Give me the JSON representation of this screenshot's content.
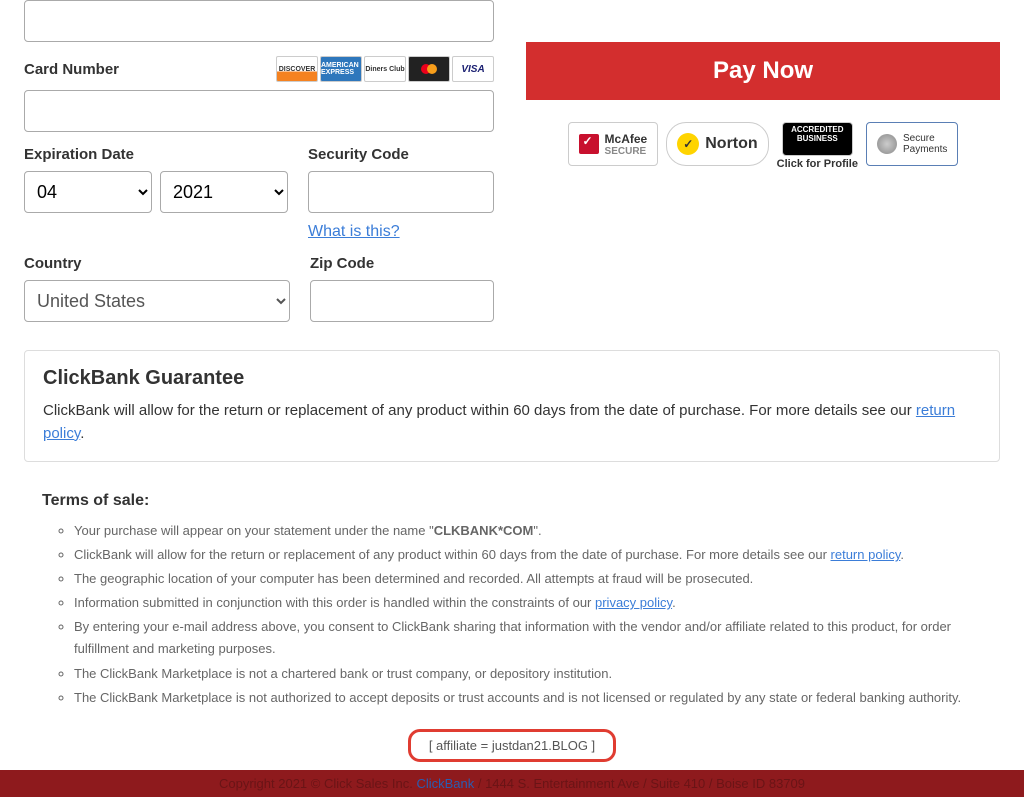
{
  "form": {
    "card_number_label": "Card Number",
    "expiration_label": "Expiration Date",
    "security_label": "Security Code",
    "what_is_this": "What is this?",
    "country_label": "Country",
    "zip_label": "Zip Code",
    "month_value": "04",
    "year_value": "2021",
    "country_value": "United States"
  },
  "cards": {
    "discover": "DISCOVER",
    "amex": "AMERICAN EXPRESS",
    "diners": "Diners Club",
    "visa": "VISA"
  },
  "pay_button": "Pay Now",
  "badges": {
    "mcafee_1": "McAfee",
    "mcafee_2": "SECURE",
    "norton": "Norton",
    "bbb_1": "ACCREDITED",
    "bbb_2": "BUSINESS",
    "bbb_click": "Click for Profile",
    "secure_1": "Secure",
    "secure_2": "Payments"
  },
  "guarantee": {
    "title": "ClickBank Guarantee",
    "text_1": "ClickBank will allow for the return or replacement of any product within 60 days from the date of purchase. For more details see our ",
    "link": "return policy",
    "text_2": "."
  },
  "terms": {
    "title": "Terms of sale:",
    "item1_a": "Your purchase will appear on your statement under the name \"",
    "item1_b": "CLKBANK*COM",
    "item1_c": "\".",
    "item2_a": "ClickBank will allow for the return or replacement of any product within 60 days from the date of purchase. For more details see our ",
    "item2_link": "return policy",
    "item2_b": ".",
    "item3": "The geographic location of your computer has been determined and recorded. All attempts at fraud will be prosecuted.",
    "item4_a": "Information submitted in conjunction with this order is handled within the constraints of our ",
    "item4_link": "privacy policy",
    "item4_b": ".",
    "item5": "By entering your e-mail address above, you consent to ClickBank sharing that information with the vendor and/or affiliate related to this product, for order fulfillment and marketing purposes.",
    "item6": "The ClickBank Marketplace is not a chartered bank or trust company, or depository institution.",
    "item7": "The ClickBank Marketplace is not authorized to accept deposits or trust accounts and is not licensed or regulated by any state or federal banking authority."
  },
  "affiliate": "[ affiliate = justdan21.BLOG ]",
  "footer": {
    "a": "Copyright 2021 © Click Sales Inc. ",
    "cb": "ClickBank",
    "b": " / 1444 S. Entertainment Ave / Suite 410 / Boise ID 83709"
  }
}
